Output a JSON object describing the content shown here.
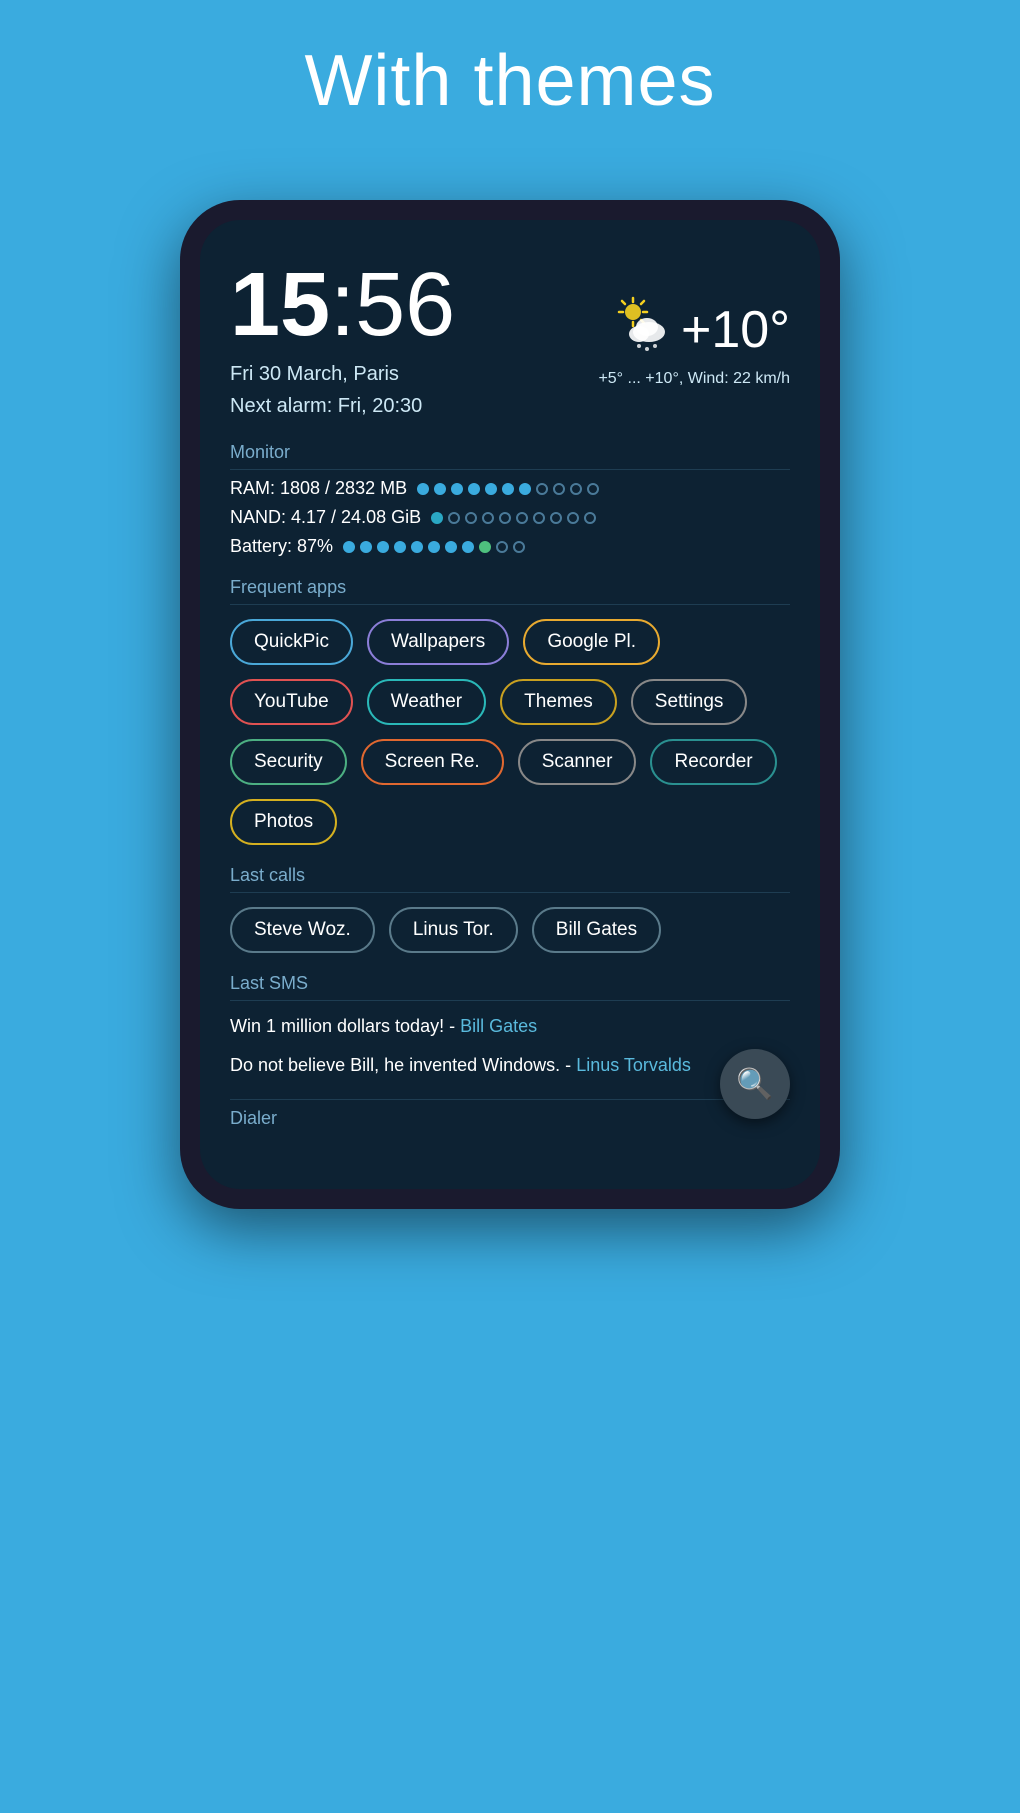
{
  "page": {
    "title": "With themes",
    "background": "#3aabdf"
  },
  "clock": {
    "hour": "15",
    "minutes": "56",
    "date": "Fri 30 March, Paris",
    "alarm": "Next alarm: Fri, 20:30"
  },
  "weather": {
    "temp": "+10°",
    "detail": "+5° ... +10°, Wind: 22 km/h"
  },
  "monitor": {
    "label": "Monitor",
    "ram": "RAM: 1808 / 2832 MB",
    "nand": "NAND: 4.17 / 24.08 GiB",
    "battery": "Battery: 87%"
  },
  "frequent_apps": {
    "label": "Frequent apps",
    "apps": [
      {
        "name": "QuickPic",
        "color_class": "badge-blue"
      },
      {
        "name": "Wallpapers",
        "color_class": "badge-purple"
      },
      {
        "name": "Google Pl.",
        "color_class": "badge-orange"
      },
      {
        "name": "YouTube",
        "color_class": "badge-red"
      },
      {
        "name": "Weather",
        "color_class": "badge-teal"
      },
      {
        "name": "Themes",
        "color_class": "badge-yellow-dark"
      },
      {
        "name": "Settings",
        "color_class": "badge-gray"
      },
      {
        "name": "Security",
        "color_class": "badge-green"
      },
      {
        "name": "Screen Re.",
        "color_class": "badge-orange-red"
      },
      {
        "name": "Scanner",
        "color_class": "badge-gray"
      },
      {
        "name": "Recorder",
        "color_class": "badge-dark-teal"
      },
      {
        "name": "Photos",
        "color_class": "badge-yellow"
      }
    ]
  },
  "last_calls": {
    "label": "Last calls",
    "calls": [
      {
        "name": "Steve Woz."
      },
      {
        "name": "Linus Tor."
      },
      {
        "name": "Bill Gates"
      }
    ]
  },
  "last_sms": {
    "label": "Last SMS",
    "messages": [
      {
        "text": "Win 1 million dollars today! -",
        "sender": "Bill Gates"
      },
      {
        "text": "Do not believe Bill, he invented Windows. -",
        "sender": "Linus Torvalds"
      }
    ]
  },
  "dialer": {
    "label": "Dialer"
  }
}
